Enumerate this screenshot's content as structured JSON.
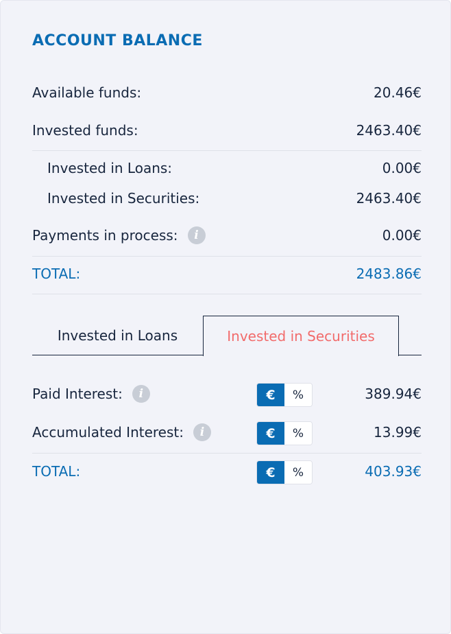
{
  "header": {
    "title": "ACCOUNT BALANCE"
  },
  "balance": {
    "available_funds": {
      "label": "Available funds:",
      "value": "20.46€"
    },
    "invested_funds": {
      "label": "Invested funds:",
      "value": "2463.40€"
    },
    "invested_loans": {
      "label": "Invested in Loans:",
      "value": "0.00€"
    },
    "invested_securities": {
      "label": "Invested in Securities:",
      "value": "2463.40€"
    },
    "payments_in_process": {
      "label": "Payments in process:",
      "value": "0.00€"
    },
    "total": {
      "label": "TOTAL:",
      "value": "2483.86€"
    }
  },
  "tabs": {
    "loans": "Invested in Loans",
    "securities": "Invested in Securities",
    "active": "securities"
  },
  "interest": {
    "toggle": {
      "euro": "€",
      "percent": "%",
      "selected": "euro"
    },
    "paid": {
      "label": "Paid Interest:",
      "value": "389.94€"
    },
    "accumulated": {
      "label": "Accumulated Interest:",
      "value": "13.99€"
    },
    "total": {
      "label": "TOTAL:",
      "value": "403.93€"
    }
  },
  "icons": {
    "info": "i"
  },
  "colors": {
    "accent": "#0a6cb3",
    "active_tab": "#f26b6b",
    "text": "#17253d",
    "background": "#f2f3f9"
  }
}
